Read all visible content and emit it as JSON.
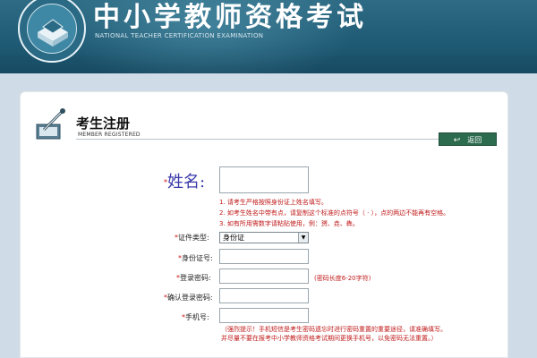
{
  "header": {
    "title": "中小学教师资格考试",
    "subtitle": "NATIONAL TEACHER CERTIFICATION EXAMINATION",
    "logo_ring_text": "National Teacher Certification Examination"
  },
  "register": {
    "title": "考生注册",
    "subtitle": "MEMBER REGISTERED",
    "back_label": "返回"
  },
  "form": {
    "name_label": "姓名:",
    "name_hints": [
      "1. 请考生严格按照身份证上姓名填写。",
      "2. 如考生姓名中带有点，请复制这个标准的点符号（ · ），点的两边不能再有空格。",
      "3. 如有所用需数字请粘贴使用，例：赟、垚、犇。"
    ],
    "id_type_label": "证件类型:",
    "id_type_value": "身份证",
    "id_number_label": "身份证号:",
    "password_label": "登录密码:",
    "password_hint": "(密码长度6-20字符)",
    "confirm_password_label": "确认登录密码:",
    "phone_label": "手机号:",
    "phone_hint_line1": "（强烈提示！手机短信是考生密码遗忘时进行密码重置的重要途径，请准确填写。",
    "phone_hint_line2": "并尽量不要在报考中小学教师资格考试期间更换手机号，以免密码无法重置。）",
    "required_mark": "*"
  }
}
